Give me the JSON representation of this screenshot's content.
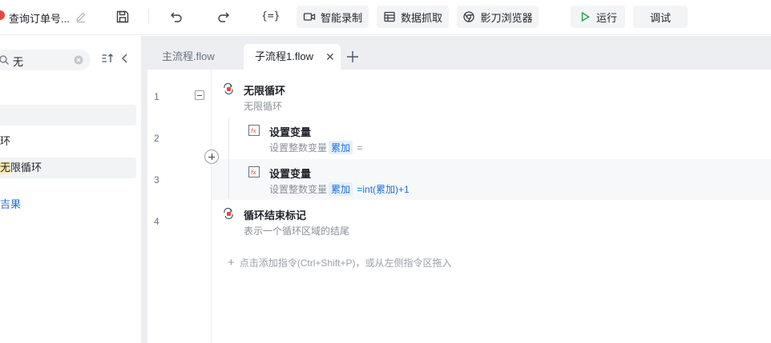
{
  "header": {
    "doc_title": "查询订单号...",
    "smart_record_label": "智能录制",
    "data_capture_label": "数据抓取",
    "browser_label": "影刀浏览器",
    "run_label": "运行",
    "debug_label": "调试",
    "variable_icon_text": "{=}"
  },
  "sidebar": {
    "search": {
      "value": "无"
    },
    "items": [
      {
        "text": ""
      },
      {
        "text": "环"
      },
      {
        "highlight": "无",
        "rest": "限循环"
      },
      {
        "text": "吉果"
      }
    ]
  },
  "tabs": [
    {
      "label": "主流程.flow"
    },
    {
      "label": "子流程1.flow",
      "close": "✕"
    }
  ],
  "editor": {
    "line_numbers": [
      "1",
      "2",
      "3",
      "4"
    ],
    "steps": [
      {
        "title": "无限循环",
        "desc": "无限循环"
      },
      {
        "title": "设置变量",
        "desc_prefix": "设置整数变量",
        "var": "累加",
        "desc_suffix": "="
      },
      {
        "title": "设置变量",
        "desc_prefix": "设置整数变量",
        "var": "累加",
        "expr": "=int(累加)+1"
      },
      {
        "title": "循环结束标记",
        "desc": "表示一个循环区域的结尾"
      }
    ],
    "add_hint": "点击添加指令(Ctrl+Shift+P)，或从左侧指令区拖入",
    "add_hint_plus": "+"
  },
  "colors": {
    "accent_blue": "#1e6fd9",
    "run_green": "#1fa34a",
    "highlight_yellow": "#fbe9a9",
    "loop_icon_red": "#e5483f"
  },
  "icons": {
    "doc": "app-logo-icon",
    "edit": "pencil-icon",
    "save": "save-icon",
    "undo": "undo-icon",
    "redo": "redo-icon",
    "variable": "variable-icon",
    "record": "video-camera-icon",
    "capture": "table-grid-icon",
    "browser": "browser-icon",
    "run": "play-icon",
    "search": "search-icon",
    "clear": "clear-circle-icon",
    "sort": "sort-icon",
    "collapse": "chevron-left-icon",
    "loop": "loop-icon",
    "variable_fx": "fx-icon",
    "loop_end": "loop-end-icon"
  }
}
